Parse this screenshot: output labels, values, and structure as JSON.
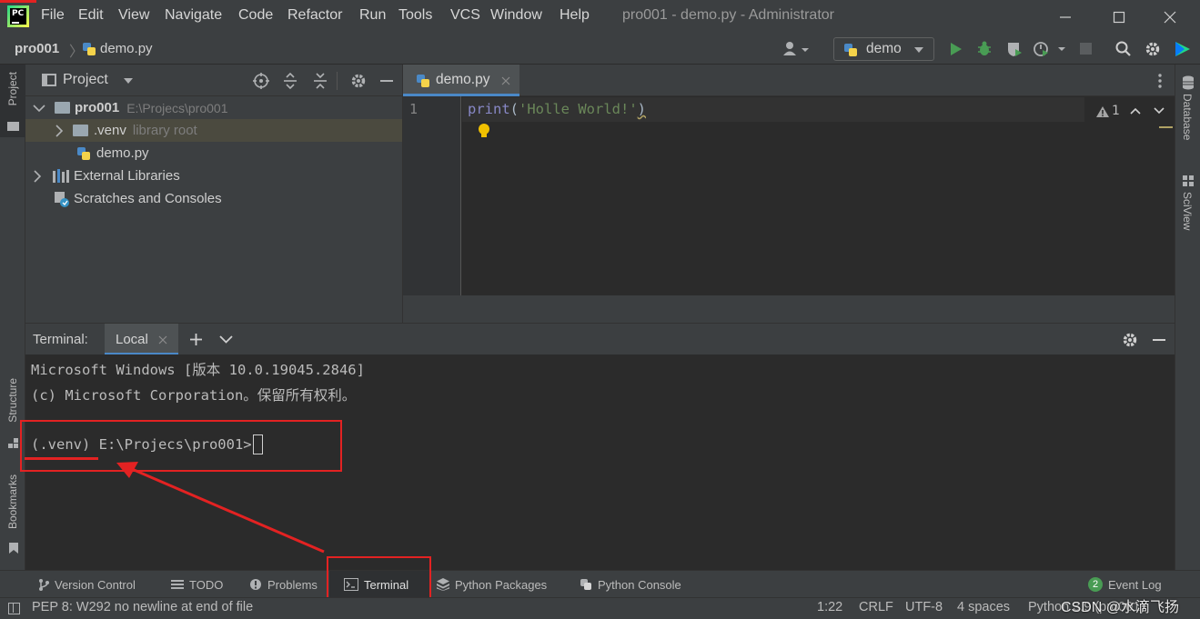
{
  "window": {
    "title": "pro001 - demo.py - Administrator",
    "menu": [
      "File",
      "Edit",
      "View",
      "Navigate",
      "Code",
      "Refactor",
      "Run",
      "Tools",
      "VCS",
      "Window",
      "Help"
    ]
  },
  "navbar": {
    "breadcrumb_project": "pro001",
    "breadcrumb_file": "demo.py",
    "run_config": "demo"
  },
  "project_panel": {
    "title": "Project",
    "tree": {
      "root_name": "pro001",
      "root_path": "E:\\Projecs\\pro001",
      "venv_name": ".venv",
      "venv_hint": "library root",
      "file": "demo.py",
      "external_libraries": "External Libraries",
      "scratches": "Scratches and Consoles"
    }
  },
  "side_tabs": {
    "project": "Project",
    "structure": "Structure",
    "bookmarks": "Bookmarks",
    "database": "Database",
    "sciview": "SciView"
  },
  "editor": {
    "tab": "demo.py",
    "line_number": "1",
    "code_func": "print",
    "code_open": "(",
    "code_string": "'Holle World!'",
    "code_close": ")",
    "warning_count": "1"
  },
  "terminal": {
    "label": "Terminal:",
    "tab": "Local",
    "lines": [
      "Microsoft Windows [版本 10.0.19045.2846]",
      "(c) Microsoft Corporation。保留所有权利。"
    ],
    "prompt": "(.venv) E:\\Projecs\\pro001>"
  },
  "tool_windows": {
    "version_control": "Version Control",
    "todo": "TODO",
    "problems": "Problems",
    "terminal": "Terminal",
    "python_packages": "Python Packages",
    "python_console": "Python Console",
    "event_log": "Event Log",
    "event_log_count": "2"
  },
  "statusbar": {
    "message": "PEP 8: W292 no newline at end of file",
    "position": "1:22",
    "line_sep": "CRLF",
    "encoding": "UTF-8",
    "indent": "4 spaces",
    "interpreter": "Python 3.9 (pro001)",
    "watermark": "CSDN @水滴飞扬"
  },
  "colors": {
    "accent_highlight": "#e32222",
    "selection": "#4b4a3f",
    "run_green": "#499c54"
  }
}
